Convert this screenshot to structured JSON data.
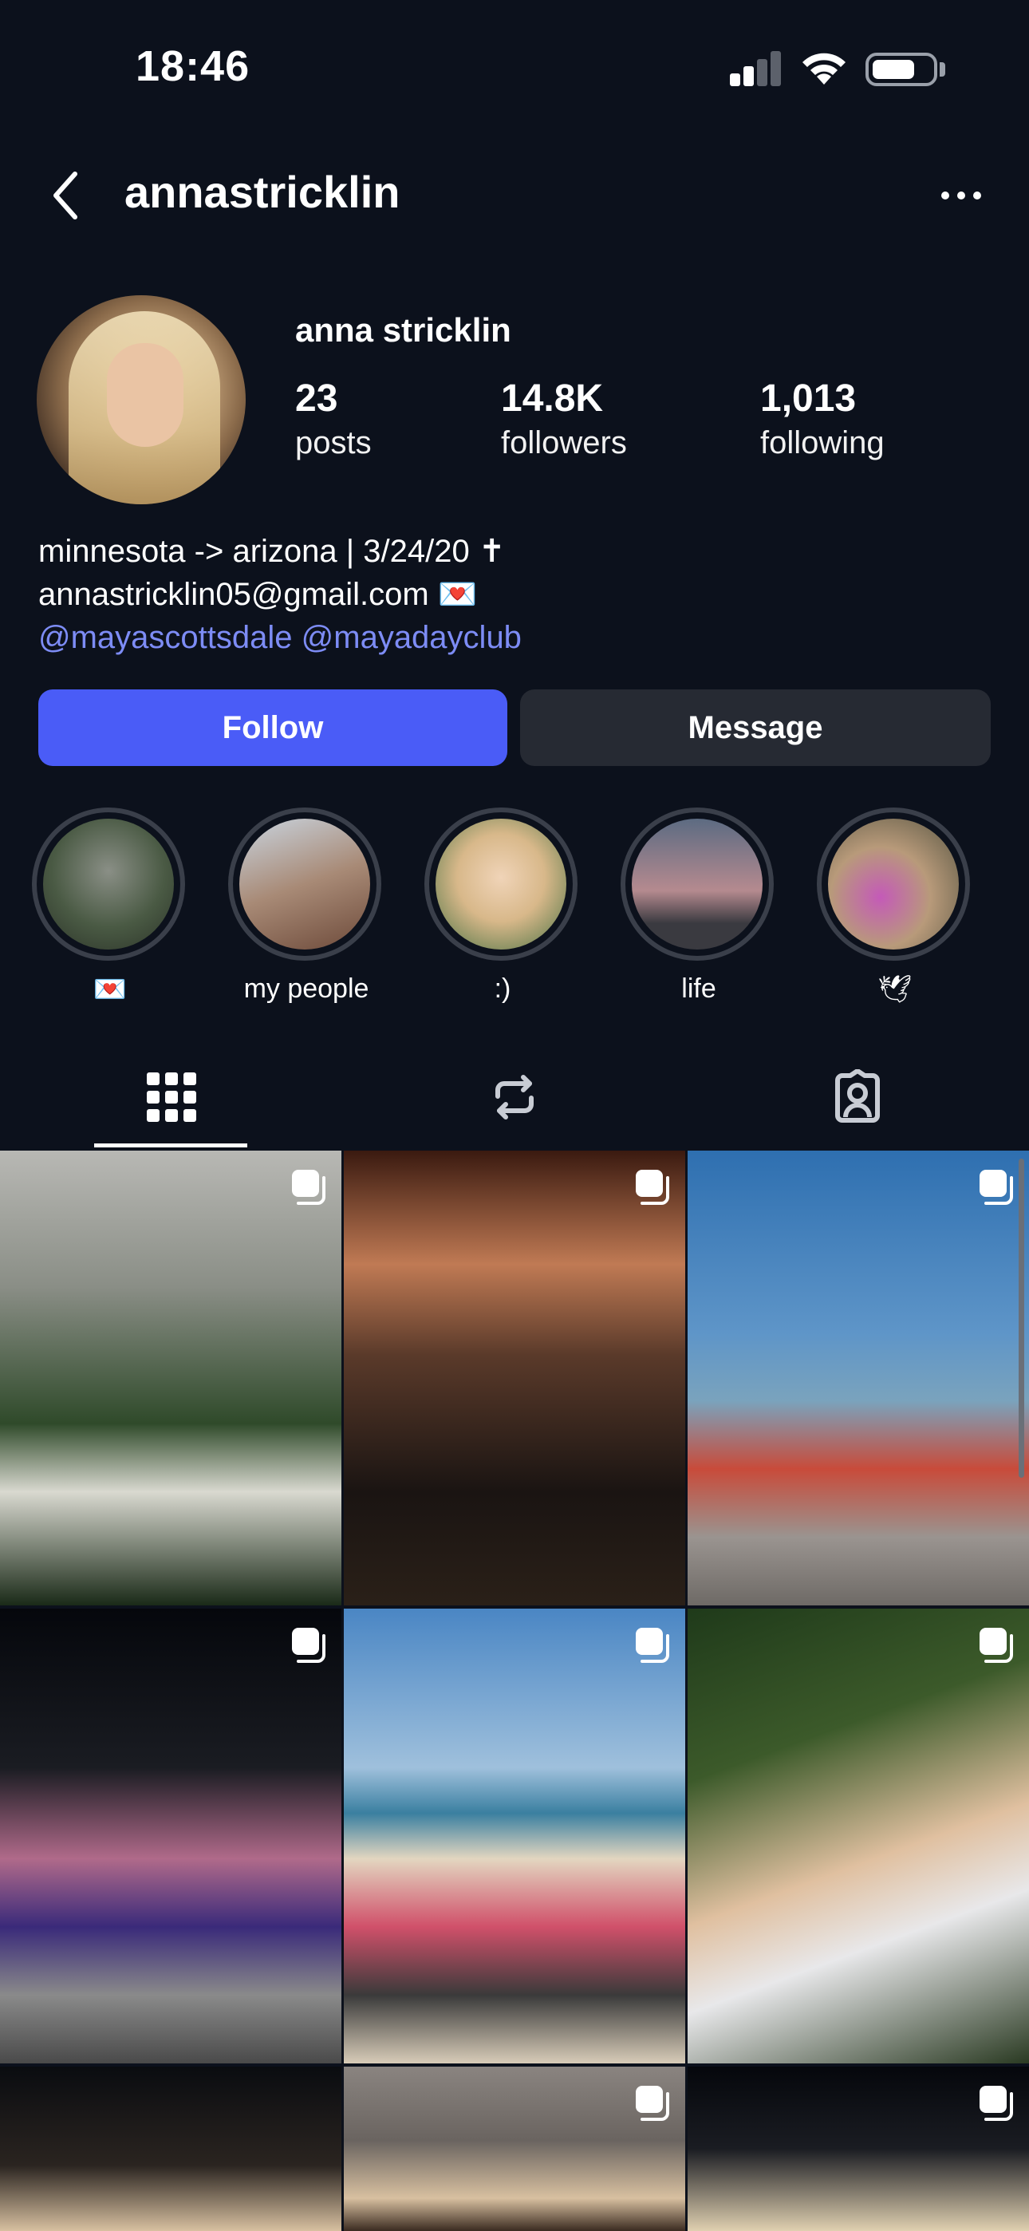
{
  "status_bar": {
    "time": "18:46",
    "battery_level": 0.72
  },
  "header": {
    "username": "annastricklin"
  },
  "profile": {
    "display_name": "anna stricklin",
    "stats": [
      {
        "value": "23",
        "label": "posts"
      },
      {
        "value": "14.8K",
        "label": "followers"
      },
      {
        "value": "1,013",
        "label": "following"
      }
    ],
    "bio": {
      "line1": "minnesota -> arizona | 3/24/20 ✝︎",
      "line2": "annastricklin05@gmail.com 💌",
      "link1": "@mayascottsdale",
      "link2": "@mayadayclub"
    }
  },
  "actions": {
    "follow_label": "Follow",
    "message_label": "Message"
  },
  "highlights": [
    {
      "label": "💌",
      "icon": "love-letter"
    },
    {
      "label": "my people"
    },
    {
      "label": ":)"
    },
    {
      "label": "life"
    },
    {
      "label": "🕊",
      "icon": "dove"
    }
  ],
  "tabs": [
    {
      "icon": "grid-icon",
      "active": true
    },
    {
      "icon": "reposts-icon",
      "active": false
    },
    {
      "icon": "tagged-icon",
      "active": false
    }
  ],
  "colors": {
    "background": "#0c111c",
    "follow_button": "#4a5cf7",
    "message_button": "#262a33",
    "link": "#7d8cf5"
  },
  "posts": [
    {
      "multi": true
    },
    {
      "multi": true
    },
    {
      "multi": true
    },
    {
      "multi": true
    },
    {
      "multi": true
    },
    {
      "multi": true
    },
    {
      "multi": false
    },
    {
      "multi": true
    },
    {
      "multi": true
    }
  ]
}
